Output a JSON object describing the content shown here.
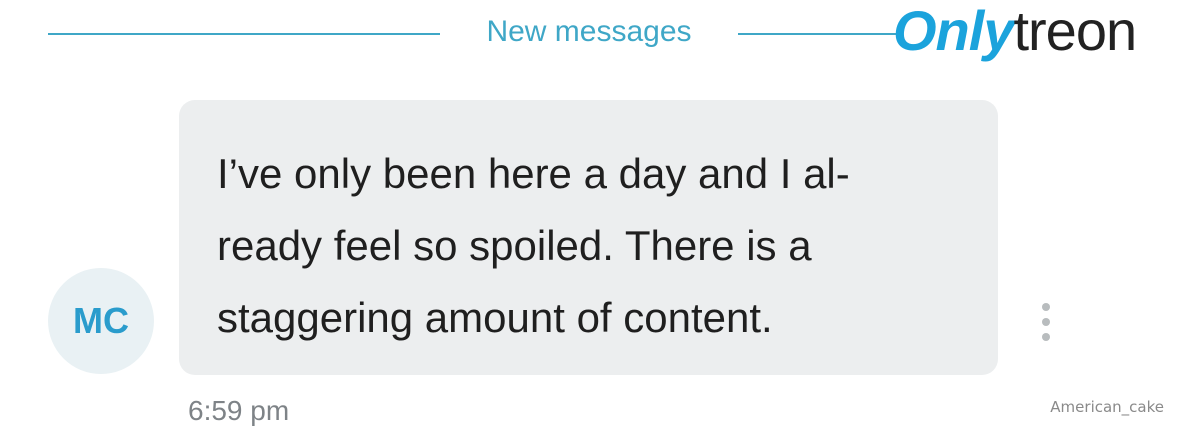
{
  "header": {
    "divider_label": "New messages",
    "accent_color": "#3fa7c7"
  },
  "logo": {
    "part1": "Only",
    "part2": "treon",
    "part1_color": "#1ba3dc",
    "part2_color": "#222222"
  },
  "message": {
    "avatar_initials": "MC",
    "text": "I’ve only been here a day and I al-ready feel so spoiled. There is a staggering amount of content.",
    "line1": "I’ve only been here a day and I al-",
    "line2": "ready feel so spoiled. There is a",
    "line3": "staggering amount of content.",
    "time": "6:59 pm",
    "more_icon": "more-vertical-icon"
  },
  "watermark": {
    "text": "American_cake"
  }
}
